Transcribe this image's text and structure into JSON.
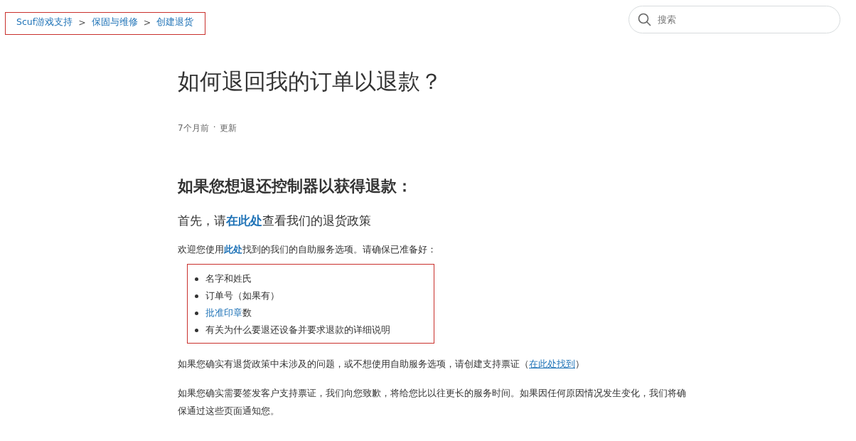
{
  "breadcrumb": {
    "highlighted": true,
    "items": [
      "Scuf游戏支持",
      "保固与维修",
      "创建退货"
    ],
    "separator": ">"
  },
  "search": {
    "placeholder": "搜索"
  },
  "article": {
    "title": "如何退回我的订单以退款？",
    "meta": {
      "age": "7个月前",
      "separator": "·",
      "action": "更新"
    },
    "heading": "如果您想退还控制器以获得退款：",
    "subheading": [
      {
        "text": "首先，请",
        "link": false
      },
      {
        "text": "在此处",
        "link": true
      },
      {
        "text": "查看我们的退货政策",
        "link": false
      }
    ],
    "intro": [
      {
        "text": "欢迎您使用",
        "link": false
      },
      {
        "text": "此处",
        "link": true,
        "bold": true
      },
      {
        "text": "找到的我们的自助服务选项。请确保已准备好：",
        "link": false
      }
    ],
    "list": {
      "highlighted": true,
      "items": [
        [
          {
            "text": "名字和姓氏",
            "link": false
          }
        ],
        [
          {
            "text": "订单号（如果有）",
            "link": false
          }
        ],
        [
          {
            "text": "批准印章",
            "link": true
          },
          {
            "text": "数",
            "link": false
          }
        ],
        [
          {
            "text": "有关为什么要退还设备并要求退款的详细说明",
            "link": false
          }
        ]
      ]
    },
    "paragraphs": [
      [
        {
          "text": "如果您确实有退货政策中未涉及的问题，或不想使用自助服务选项，请创建支持票证（",
          "link": false
        },
        {
          "text": "在此处找到",
          "link": true,
          "underline": true
        },
        {
          "text": "）",
          "link": false
        }
      ],
      [
        {
          "text": "如果您确实需要签发客户支持票证，我们向您致歉，将给您比以往更长的服务时间。如果因任何原因情况发生变化，我们将确保通过这些页面通知您。",
          "link": false
        }
      ]
    ]
  }
}
